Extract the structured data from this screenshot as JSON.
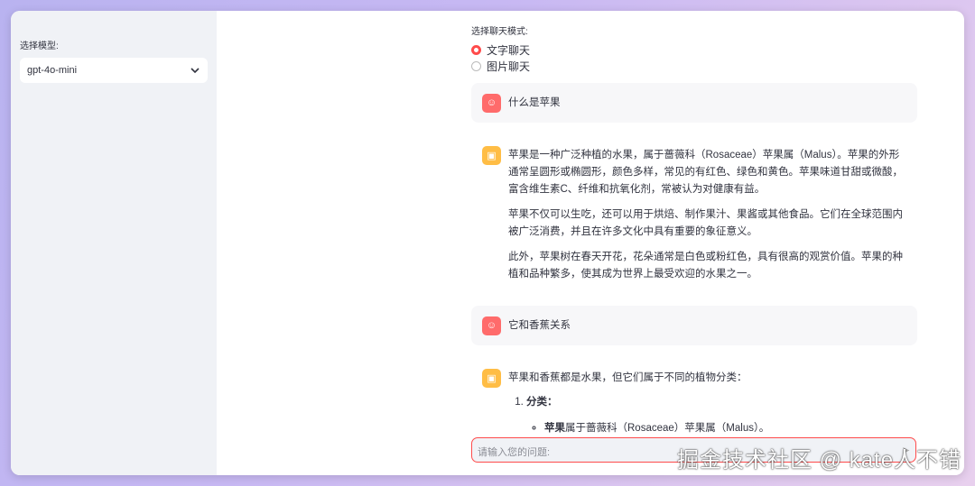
{
  "sidebar": {
    "model_label": "选择模型:",
    "model_value": "gpt-4o-mini"
  },
  "mode": {
    "label": "选择聊天模式:",
    "options": [
      "文字聊天",
      "图片聊天"
    ],
    "selected": "文字聊天"
  },
  "messages": [
    {
      "role": "user",
      "text": "什么是苹果"
    },
    {
      "role": "assistant",
      "paragraphs": [
        "苹果是一种广泛种植的水果，属于蔷薇科（Rosaceae）苹果属（Malus）。苹果的外形通常呈圆形或椭圆形，颜色多样，常见的有红色、绿色和黄色。苹果味道甘甜或微酸，富含维生素C、纤维和抗氧化剂，常被认为对健康有益。",
        "苹果不仅可以生吃，还可以用于烘焙、制作果汁、果酱或其他食品。它们在全球范围内被广泛消费，并且在许多文化中具有重要的象征意义。",
        "此外，苹果树在春天开花，花朵通常是白色或粉红色，具有很高的观赏价值。苹果的种植和品种繁多，使其成为世界上最受欢迎的水果之一。"
      ]
    },
    {
      "role": "user",
      "text": "它和香蕉关系"
    },
    {
      "role": "assistant",
      "intro": "苹果和香蕉都是水果，但它们属于不同的植物分类：",
      "list_item": "分类：",
      "sub_bold": "苹果",
      "sub_rest": "属于蔷薇科（Rosaceae）苹果属（Malus）。"
    }
  ],
  "input": {
    "placeholder": "请输入您的问题:"
  },
  "watermark": "掘金技术社区 @ kate人不错"
}
